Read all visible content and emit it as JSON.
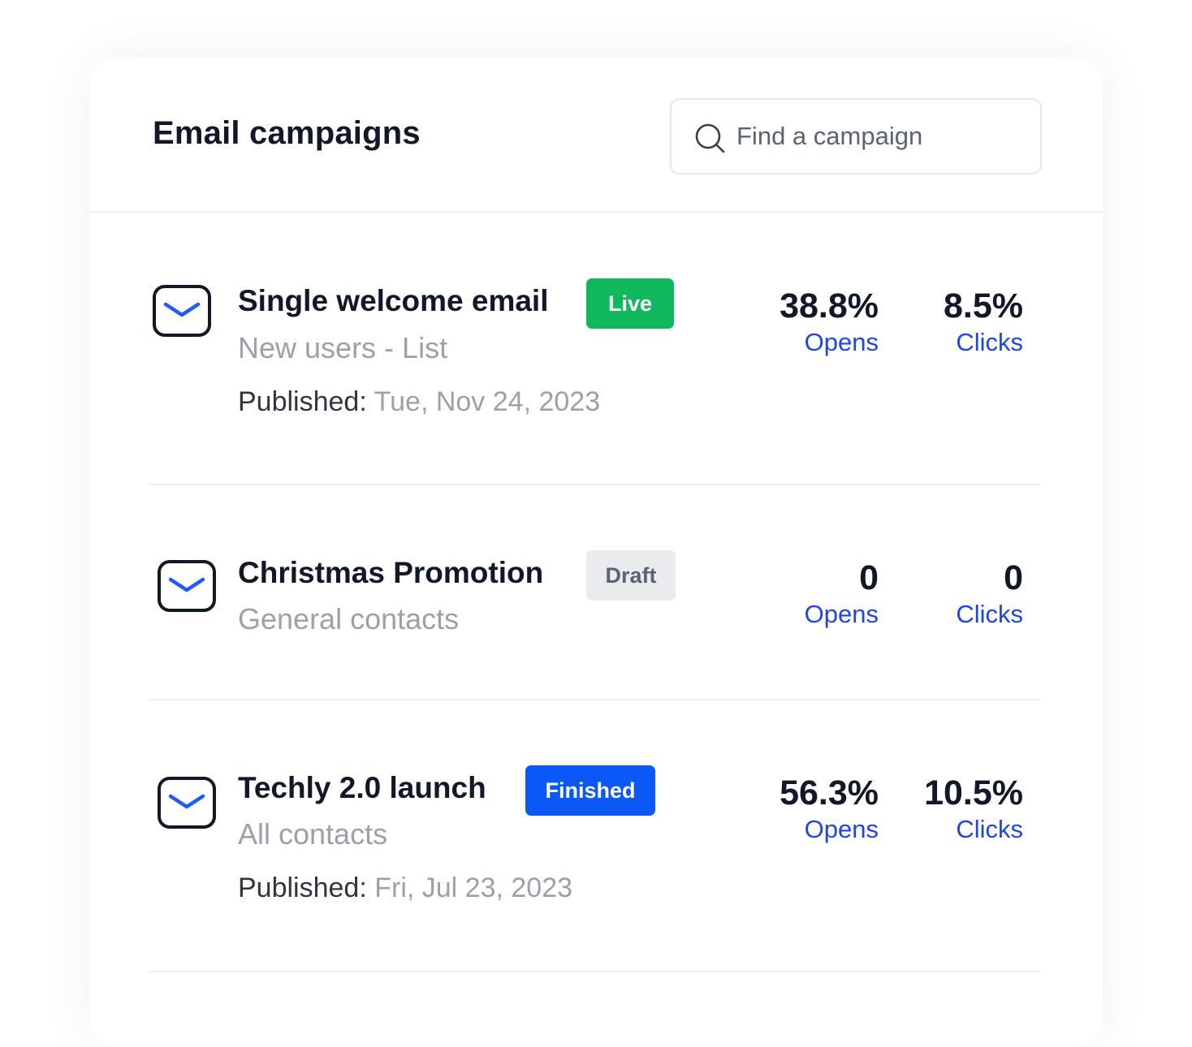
{
  "header": {
    "title": "Email campaigns",
    "search_placeholder": "Find a campaign"
  },
  "campaigns": [
    {
      "name": "Single welcome email",
      "status": "Live",
      "audience": "New users - List",
      "published_label": "Published:",
      "published_date": "Tue, Nov 24, 2023",
      "opens_value": "38.8%",
      "opens_label": "Opens",
      "clicks_value": "8.5%",
      "clicks_label": "Clicks"
    },
    {
      "name": "Christmas Promotion",
      "status": "Draft",
      "audience": "General contacts",
      "opens_value": "0",
      "opens_label": "Opens",
      "clicks_value": "0",
      "clicks_label": "Clicks"
    },
    {
      "name": "Techly 2.0 launch",
      "status": "Finished",
      "audience": "All contacts",
      "published_label": "Published:",
      "published_date": "Fri, Jul 23, 2023",
      "opens_value": "56.3%",
      "opens_label": "Opens",
      "clicks_value": "10.5%",
      "clicks_label": "Clicks"
    }
  ],
  "colors": {
    "live": "#0fb85c",
    "draft": "#e9ebef",
    "finished": "#0a58f5",
    "metric_label": "#1f45e6",
    "icon_accent": "#1f5cf5"
  },
  "icons": {
    "search": "search-icon",
    "campaign": "mail-icon"
  }
}
